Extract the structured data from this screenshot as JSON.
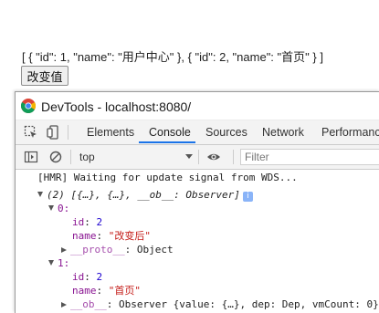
{
  "page": {
    "array_text": "[ { \"id\": 1, \"name\": \"用户中心\" }, { \"id\": 2, \"name\": \"首页\" } ]",
    "button_label": "改变值"
  },
  "devtools": {
    "title": "DevTools - localhost:8080/",
    "tabs": [
      "Elements",
      "Console",
      "Sources",
      "Network",
      "Performance"
    ],
    "active_tab": "Console",
    "context": "top",
    "filter_placeholder": "Filter"
  },
  "console": {
    "hmr": "[HMR] Waiting for update signal from WDS...",
    "array_summary": "(2) [{…}, {…}, __ob__: Observer]",
    "index0": "0:",
    "id_key": "id",
    "id0": "2",
    "name_key": "name",
    "name0": "\"改变后\"",
    "proto_key": "__proto__",
    "proto_val": "Object",
    "index1": "1:",
    "id1": "2",
    "name1": "\"首页\"",
    "ob_key": "__ob__",
    "ob_val": "Observer {value: {…}, dep: Dep, vmCount: 0}"
  },
  "colors": {
    "accent": "#1a73e8",
    "key_purple": "#881391",
    "number_blue": "#1c00cf",
    "string_red": "#c41a16"
  }
}
